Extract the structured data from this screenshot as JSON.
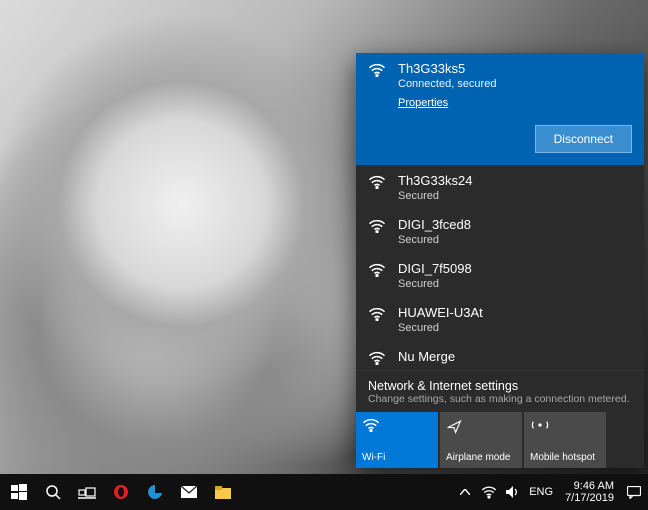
{
  "connected": {
    "ssid": "Th3G33ks5",
    "status": "Connected, secured",
    "properties": "Properties",
    "disconnect": "Disconnect"
  },
  "networks": [
    {
      "ssid": "Th3G33ks24",
      "status": "Secured"
    },
    {
      "ssid": "DIGI_3fced8",
      "status": "Secured"
    },
    {
      "ssid": "DIGI_7f5098",
      "status": "Secured"
    },
    {
      "ssid": "HUAWEI-U3At",
      "status": "Secured"
    },
    {
      "ssid": "Nu Merge",
      "status": ""
    }
  ],
  "settings": {
    "title": "Network & Internet settings",
    "subtitle": "Change settings, such as making a connection metered."
  },
  "tiles": {
    "wifi": "Wi-Fi",
    "airplane": "Airplane mode",
    "hotspot": "Mobile hotspot"
  },
  "tray": {
    "lang": "ENG",
    "time": "9:46 AM",
    "date": "7/17/2019"
  }
}
